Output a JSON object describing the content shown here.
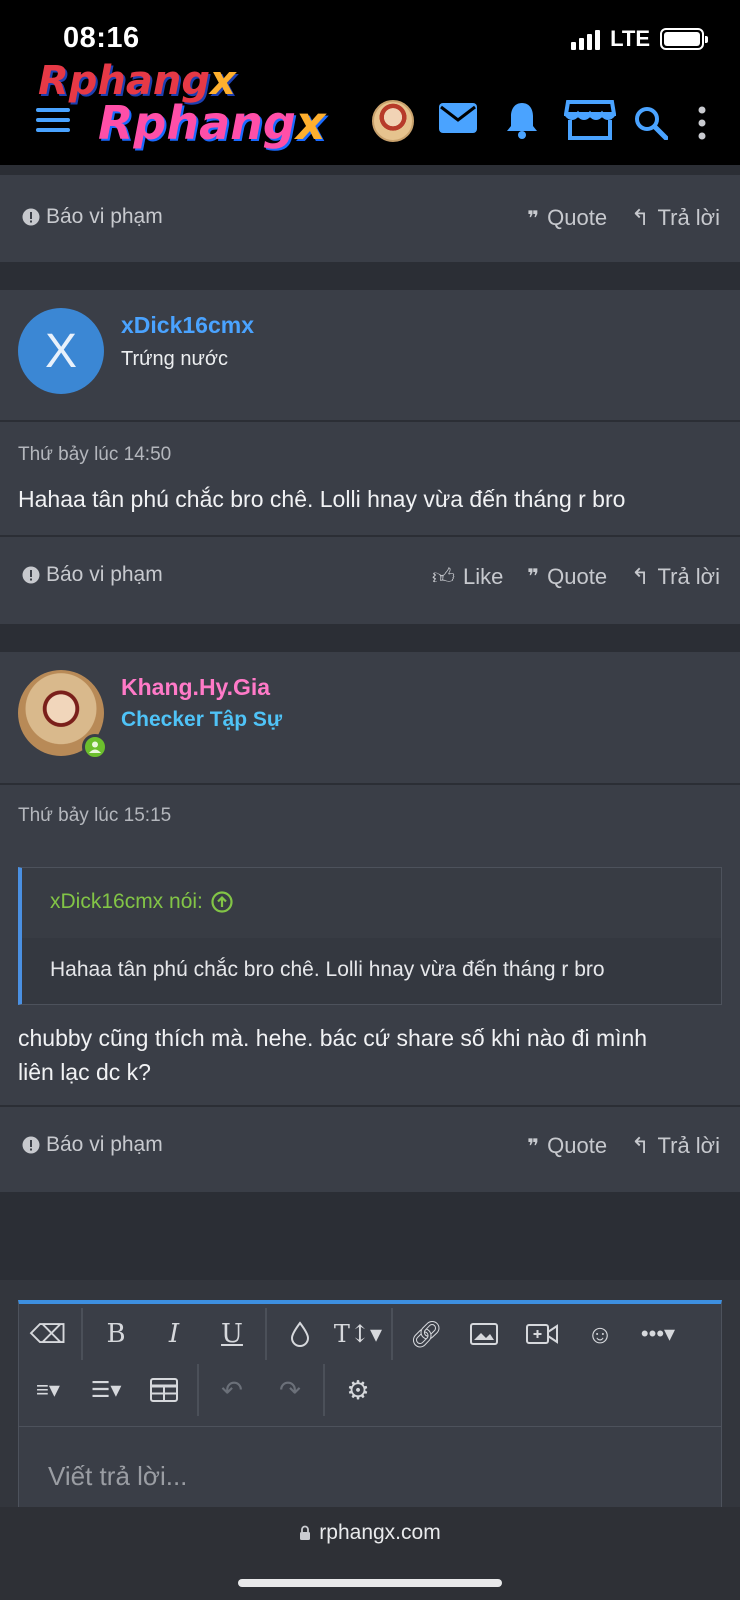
{
  "status_bar": {
    "time": "08:16",
    "network": "LTE"
  },
  "header": {
    "logo_text_1": "Rphangx",
    "logo_text_2": "Rphangx",
    "icons": [
      "menu-icon",
      "avatar",
      "mail-icon",
      "bell-icon",
      "store-icon",
      "search-icon",
      "more-vertical-icon"
    ],
    "accent_color": "#4aa3ff"
  },
  "post_actions_labels": {
    "report": "Báo vi phạm",
    "like": "Like",
    "quote": "Quote",
    "reply": "Trả lời"
  },
  "posts": [
    {
      "username": "xDick16cmx",
      "avatar_letter": "X",
      "user_title": "Trứng nước",
      "username_color": "#4aa3ff",
      "date": "Thứ bảy lúc 14:50",
      "body": "Hahaa tân phú chắc bro chê. Lolli hnay vừa đến tháng r bro"
    },
    {
      "username": "Khang.Hy.Gia",
      "user_title": "Checker Tập Sự",
      "username_color": "#ff7ac8",
      "title_color": "#4fc3f7",
      "date": "Thứ bảy lúc 15:15",
      "quote": {
        "author": "xDick16cmx nói:",
        "text": "Hahaa tân phú chắc bro chê. Lolli hnay vừa đến tháng r bro"
      },
      "body_line_1": "chubby cũng thích mà. hehe. bác cứ share số khi nào đi mình",
      "body_line_2": "liên lạc dc k?"
    }
  ],
  "editor": {
    "placeholder": "Viết trả lời...",
    "toolbar_row_1": [
      "eraser-icon",
      "bold-icon",
      "italic-icon",
      "underline-icon",
      "color-drop-icon",
      "text-size-icon",
      "link-icon",
      "image-icon",
      "video-icon",
      "emoji-icon",
      "more-horizontal-icon"
    ],
    "toolbar_row_2": [
      "align-icon",
      "list-icon",
      "table-icon",
      "undo-icon",
      "redo-icon",
      "settings-icon"
    ]
  },
  "browser": {
    "url": "rphangx.com"
  }
}
